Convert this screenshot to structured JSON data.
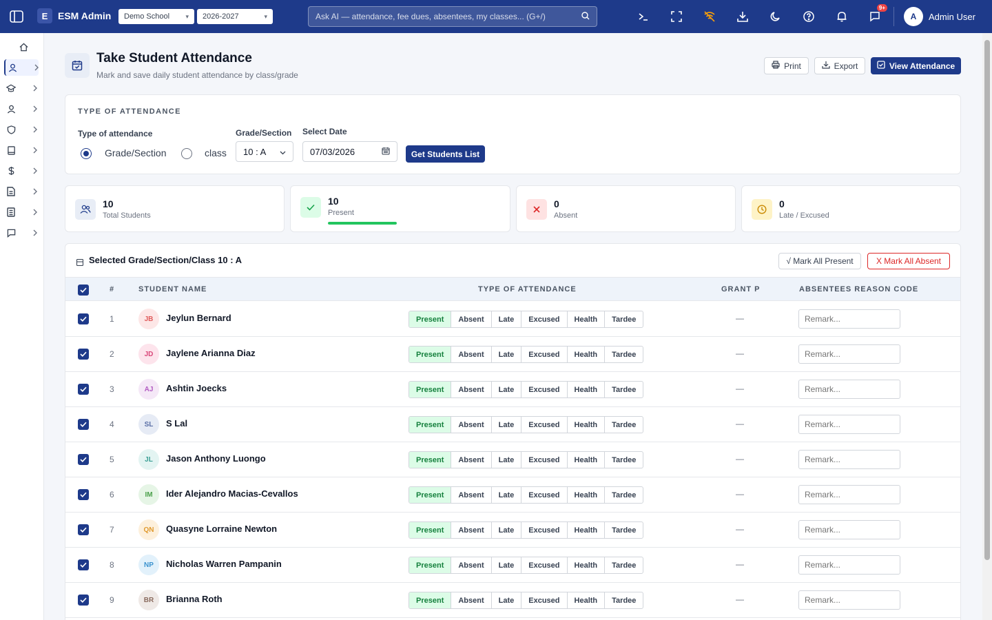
{
  "topbar": {
    "brand_letter": "E",
    "brand_name": "ESM Admin",
    "school": "Demo School",
    "year": "2026-2027",
    "search_placeholder": "Ask AI — attendance, fee dues, absentees, my classes... (G+/)",
    "notification_badge": "9+",
    "user_initial": "A",
    "user_name": "Admin User"
  },
  "page": {
    "title": "Take Student Attendance",
    "subtitle": "Mark and save daily student attendance by class/grade",
    "print_label": "Print",
    "export_label": "Export",
    "view_label": "View Attendance"
  },
  "filters": {
    "section_title": "TYPE OF ATTENDANCE",
    "type_label": "Type of attendance",
    "option_grade": "Grade/Section",
    "option_class": "class",
    "grade_label": "Grade/Section",
    "grade_value": "10 : A",
    "date_label": "Select Date",
    "date_value": "07/03/2026",
    "get_button": "Get Students List"
  },
  "stats": {
    "total": {
      "value": "10",
      "label": "Total Students"
    },
    "present": {
      "value": "10",
      "label": "Present",
      "progress": 1.0
    },
    "absent": {
      "value": "0",
      "label": "Absent"
    },
    "late": {
      "value": "0",
      "label": "Late / Excused"
    }
  },
  "table": {
    "title": "Selected Grade/Section/Class 10 : A",
    "mark_present": "√ Mark All Present",
    "mark_absent": "X Mark All Absent",
    "headers": {
      "num": "#",
      "name": "STUDENT NAME",
      "type": "TYPE OF ATTENDANCE",
      "grant": "GRANT P",
      "reason": "ABSENTEES REASON CODE"
    },
    "options": [
      "Present",
      "Absent",
      "Late",
      "Excused",
      "Health",
      "Tardee"
    ],
    "remark_placeholder": "Remark...",
    "empty_value": "—",
    "rows": [
      {
        "num": "1",
        "initials": "JB",
        "name": "Jeylun Bernard",
        "bg": "#fde7e7",
        "fg": "#e05c5c"
      },
      {
        "num": "2",
        "initials": "JD",
        "name": "Jaylene Arianna Diaz",
        "bg": "#fde4ec",
        "fg": "#d9487a"
      },
      {
        "num": "3",
        "initials": "AJ",
        "name": "Ashtin Joecks",
        "bg": "#f5e8f7",
        "fg": "#b25cc2"
      },
      {
        "num": "4",
        "initials": "SL",
        "name": "S Lal",
        "bg": "#e6ebf5",
        "fg": "#5a6fa6"
      },
      {
        "num": "5",
        "initials": "JL",
        "name": "Jason Anthony Luongo",
        "bg": "#e3f4f2",
        "fg": "#3a9e94"
      },
      {
        "num": "6",
        "initials": "IM",
        "name": "Ider Alejandro Macias-Cevallos",
        "bg": "#e6f5e6",
        "fg": "#4ca04c"
      },
      {
        "num": "7",
        "initials": "QN",
        "name": "Quasyne Lorraine Newton",
        "bg": "#fdf0dc",
        "fg": "#e09a2e"
      },
      {
        "num": "8",
        "initials": "NP",
        "name": "Nicholas Warren Pampanin",
        "bg": "#e2f1fb",
        "fg": "#3c93cf"
      },
      {
        "num": "9",
        "initials": "BR",
        "name": "Brianna Roth",
        "bg": "#efe9e6",
        "fg": "#8a6b5e"
      }
    ]
  },
  "colors": {
    "primary": "#1e3a8a",
    "present": "#22c55e",
    "absent": "#ef4444",
    "late": "#eab308"
  }
}
